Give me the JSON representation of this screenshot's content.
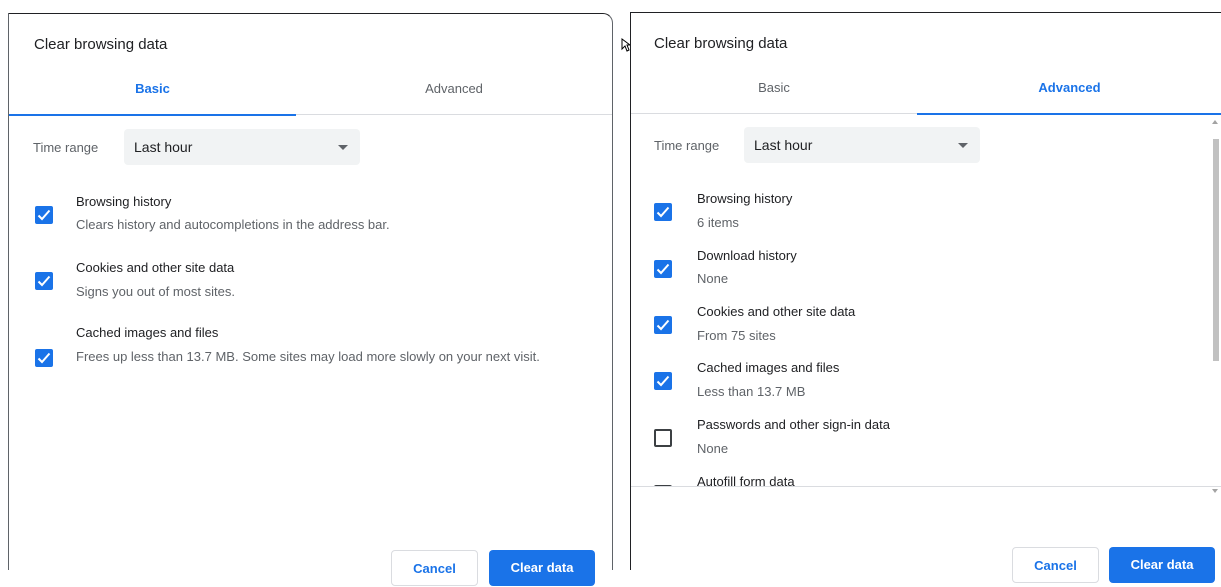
{
  "basic": {
    "title": "Clear browsing data",
    "tabs": [
      {
        "label": "Basic",
        "active": true
      },
      {
        "label": "Advanced",
        "active": false
      }
    ],
    "time_range": {
      "label": "Time range",
      "value": "Last hour"
    },
    "items": [
      {
        "title": "Browsing history",
        "desc": "Clears history and autocompletions in the address bar.",
        "checked": true
      },
      {
        "title": "Cookies and other site data",
        "desc": "Signs you out of most sites.",
        "checked": true
      },
      {
        "title": "Cached images and files",
        "desc": "Frees up less than 13.7 MB. Some sites may load more slowly on your next visit.",
        "checked": true
      }
    ],
    "cancel_label": "Cancel",
    "clear_label": "Clear data"
  },
  "advanced": {
    "title": "Clear browsing data",
    "tabs": [
      {
        "label": "Basic",
        "active": false
      },
      {
        "label": "Advanced",
        "active": true
      }
    ],
    "time_range": {
      "label": "Time range",
      "value": "Last hour"
    },
    "items": [
      {
        "title": "Browsing history",
        "desc": "6 items",
        "checked": true
      },
      {
        "title": "Download history",
        "desc": "None",
        "checked": true
      },
      {
        "title": "Cookies and other site data",
        "desc": "From 75 sites",
        "checked": true
      },
      {
        "title": "Cached images and files",
        "desc": "Less than 13.7 MB",
        "checked": true
      },
      {
        "title": "Passwords and other sign-in data",
        "desc": "None",
        "checked": false
      },
      {
        "title": "Autofill form data",
        "desc": "",
        "checked": false
      }
    ],
    "cancel_label": "Cancel",
    "clear_label": "Clear data"
  },
  "colors": {
    "accent": "#1a73e8",
    "text": "#202124",
    "secondary": "#5f6368",
    "select_bg": "#f1f3f4"
  }
}
